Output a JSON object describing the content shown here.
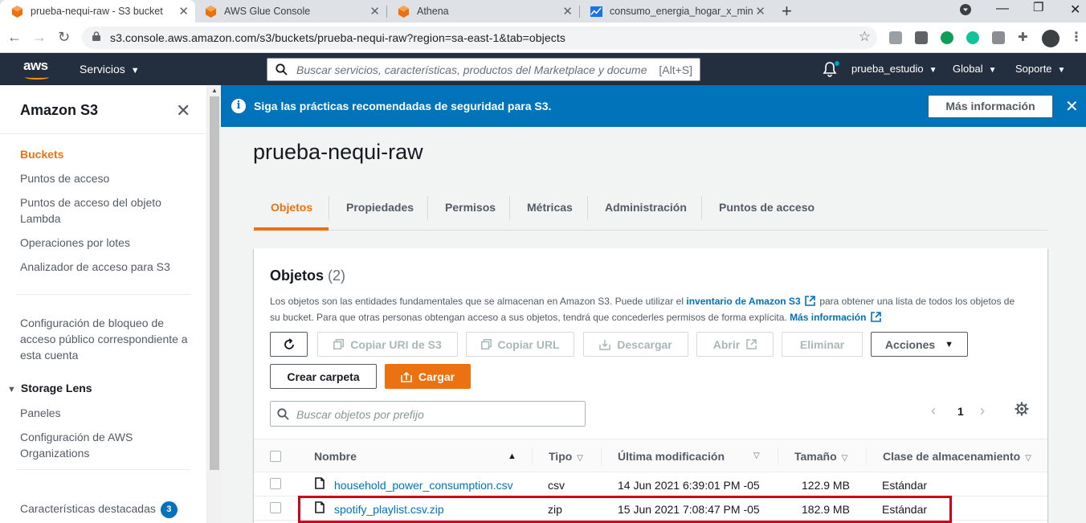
{
  "browser": {
    "tabs": [
      {
        "title": "prueba-nequi-raw - S3 bucket",
        "icon": "aws-service-icon",
        "active": true
      },
      {
        "title": "AWS Glue Console",
        "icon": "aws-service-icon",
        "active": false
      },
      {
        "title": "Athena",
        "icon": "aws-service-icon",
        "active": false
      },
      {
        "title": "consumo_energia_hogar_x_min a",
        "icon": "chart-icon",
        "active": false
      }
    ],
    "url": "s3.console.aws.amazon.com/s3/buckets/prueba-nequi-raw?region=sa-east-1&tab=objects"
  },
  "aws_nav": {
    "logo": "aws",
    "services_label": "Servicios",
    "search_placeholder": "Buscar servicios, características, productos del Marketplace y documentación",
    "search_shortcut": "[Alt+S]",
    "account": "prueba_estudio",
    "region": "Global",
    "support": "Soporte"
  },
  "sidebar": {
    "title": "Amazon S3",
    "items": [
      {
        "label": "Buckets",
        "active": true
      },
      {
        "label": "Puntos de acceso"
      },
      {
        "label": "Puntos de acceso del objeto Lambda"
      },
      {
        "label": "Operaciones por lotes"
      },
      {
        "label": "Analizador de acceso para S3"
      }
    ],
    "block_access": "Configuración de bloqueo de acceso público correspondiente a esta cuenta",
    "storage_lens": {
      "label": "Storage Lens",
      "items": [
        "Paneles",
        "Configuración de AWS Organizations"
      ]
    },
    "featured": {
      "label": "Características destacadas",
      "badge": "3"
    }
  },
  "banner": {
    "message": "Siga las prácticas recomendadas de seguridad para S3.",
    "button": "Más información"
  },
  "bucket": {
    "name": "prueba-nequi-raw",
    "tabs": [
      "Objetos",
      "Propiedades",
      "Permisos",
      "Métricas",
      "Administración",
      "Puntos de acceso"
    ]
  },
  "objects": {
    "title": "Objetos",
    "count": "(2)",
    "desc_part1": "Los objetos son las entidades fundamentales que se almacenan en Amazon S3. Puede utilizar el",
    "desc_link1": "inventario de Amazon S3",
    "desc_part2": "para obtener una lista de todos los objetos de su bucket. Para que otras personas obtengan acceso a sus objetos, tendrá que concederles permisos de forma explícita.",
    "desc_link2": "Más información",
    "buttons": {
      "copy_uri": "Copiar URI de S3",
      "copy_url": "Copiar URL",
      "download": "Descargar",
      "open": "Abrir",
      "delete": "Eliminar",
      "actions": "Acciones",
      "create_folder": "Crear carpeta",
      "upload": "Cargar"
    },
    "prefix_placeholder": "Buscar objetos por prefijo",
    "page": "1",
    "columns": [
      "Nombre",
      "Tipo",
      "Última modificación",
      "Tamaño",
      "Clase de almacenamiento"
    ],
    "rows": [
      {
        "name": "household_power_consumption.csv",
        "type": "csv",
        "modified": "14 Jun 2021 6:39:01 PM -05",
        "size": "122.9 MB",
        "class": "Estándar"
      },
      {
        "name": "spotify_playlist.csv.zip",
        "type": "zip",
        "modified": "15 Jun 2021 7:08:47 PM -05",
        "size": "182.9 MB",
        "class": "Estándar"
      }
    ]
  },
  "colors": {
    "aws_nav": "#232f3e",
    "accent": "#ec7211",
    "banner": "#0073bb",
    "link": "#0073bb",
    "highlight": "#d0021b"
  }
}
